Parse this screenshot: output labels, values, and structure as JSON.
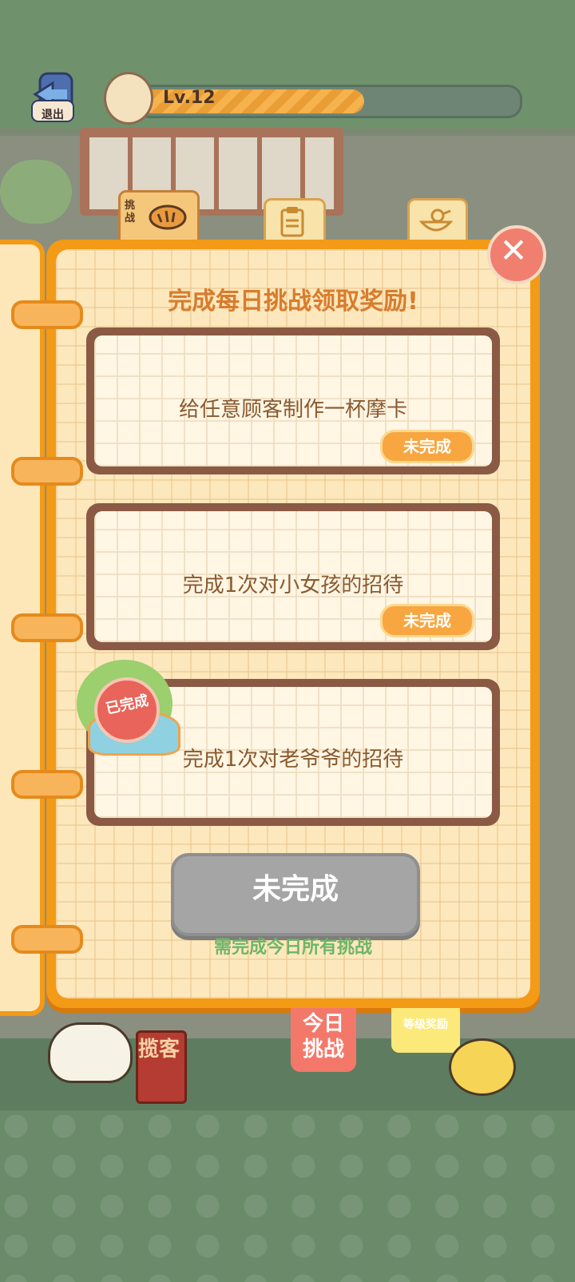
{
  "header": {
    "exit_label": "退出",
    "level_label": "Lv.12",
    "level_progress": 0.6
  },
  "tabs": [
    {
      "label": "挑战",
      "icon": "bread-icon",
      "active": true
    },
    {
      "label": "",
      "icon": "clipboard-icon",
      "active": false
    },
    {
      "label": "",
      "icon": "bird-bowl-icon",
      "active": false
    }
  ],
  "panel": {
    "title": "完成每日挑战领取奖励!",
    "challenges": [
      {
        "text": "给任意顾客制作一杯摩卡",
        "status": "未完成",
        "completed": false
      },
      {
        "text": "完成1次对小女孩的招待",
        "status": "未完成",
        "completed": false
      },
      {
        "text": "完成1次对老爷爷的招待",
        "status": "已完成",
        "completed": true
      }
    ],
    "claim_button": "未完成",
    "hint": "需完成今日所有挑战"
  },
  "bottom_tabs": {
    "today_challenge": "今日\n挑战",
    "level_reward": "等级奖励"
  },
  "scene": {
    "sign_text": "揽客"
  },
  "colors": {
    "panel_border": "#f39a17",
    "title": "#d87c2d",
    "badge": "#f8a640",
    "hint": "#6fb56a",
    "disabled_button": "#a5a5a5"
  }
}
